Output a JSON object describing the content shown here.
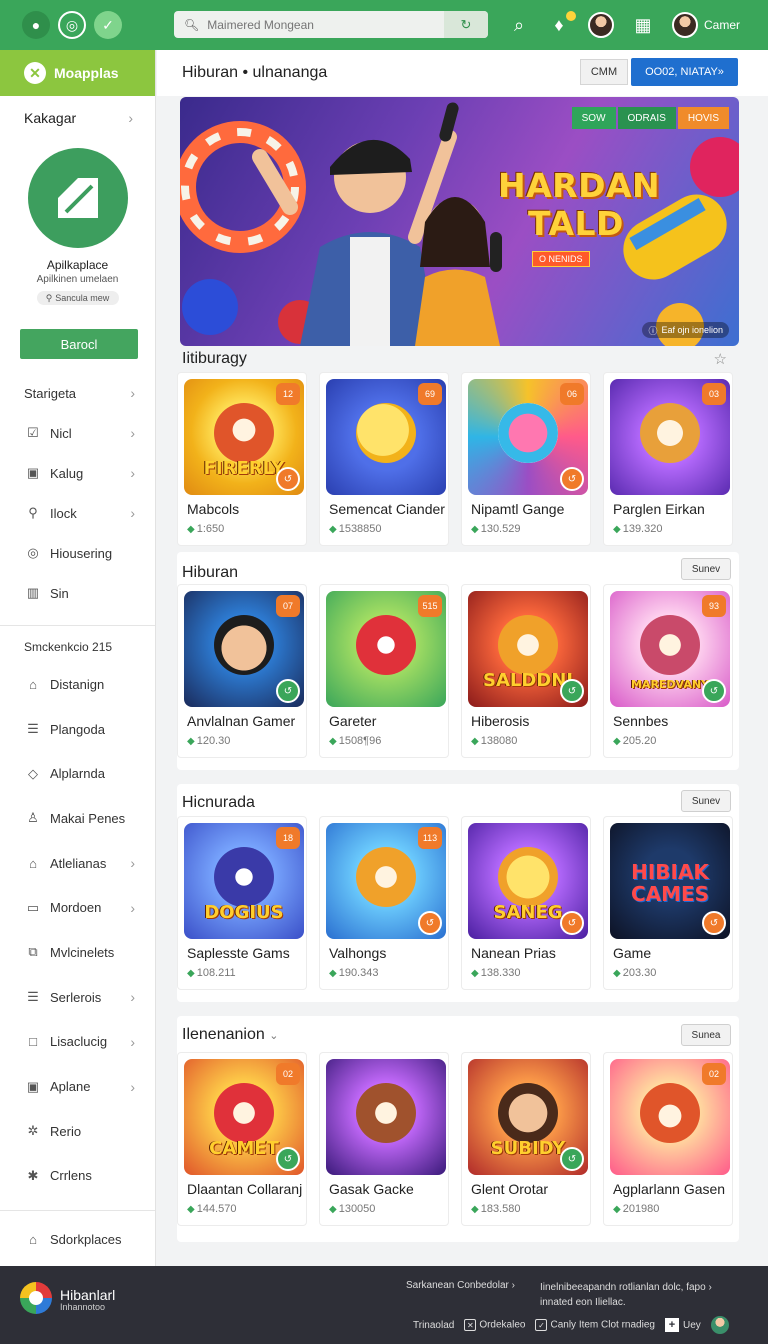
{
  "topbar": {
    "search_placeholder": "Maimered Mongean",
    "user_name": "Camer"
  },
  "sidebar": {
    "brand": "Moapplas",
    "heading": "Kakagar",
    "profile": {
      "name": "Apilkaplace",
      "subtitle": "Apilkinen umelaen",
      "tag": "Sancula mew"
    },
    "action_button": "Barocl",
    "items": [
      {
        "label": "Starigeta",
        "icon": "",
        "chevron": true
      },
      {
        "label": "Nicl",
        "icon": "checkbox-icon",
        "chevron": true
      },
      {
        "label": "Kalug",
        "icon": "photo-icon",
        "chevron": true
      },
      {
        "label": "Ilock",
        "icon": "location-icon",
        "chevron": true
      },
      {
        "label": "Hiousering",
        "icon": "target-icon",
        "chevron": false
      },
      {
        "label": "Sin",
        "icon": "columns-icon",
        "chevron": false
      }
    ],
    "section_label": "Smckenkcio 215",
    "items2": [
      {
        "label": "Distanign",
        "icon": "home-icon",
        "chevron": false
      },
      {
        "label": "Plangoda",
        "icon": "list-icon",
        "chevron": false
      },
      {
        "label": "Alplarnda",
        "icon": "tag-icon",
        "chevron": false
      },
      {
        "label": "Makai Penes",
        "icon": "user-icon",
        "chevron": false
      },
      {
        "label": "Atlelianas",
        "icon": "home-icon",
        "chevron": true
      },
      {
        "label": "Mordoen",
        "icon": "monitor-icon",
        "chevron": true
      },
      {
        "label": "Mvlcinelets",
        "icon": "layers-icon",
        "chevron": false
      },
      {
        "label": "Serlerois",
        "icon": "list-icon",
        "chevron": true
      },
      {
        "label": "Lisaclucig",
        "icon": "square-icon",
        "chevron": true
      },
      {
        "label": "Aplane",
        "icon": "photo-icon",
        "chevron": true
      },
      {
        "label": "Rerio",
        "icon": "gear-icon",
        "chevron": false
      },
      {
        "label": "Crrlens",
        "icon": "star-icon",
        "chevron": false
      }
    ],
    "bottom_item": "Sdorkplaces"
  },
  "main": {
    "title": "Hiburan • ulnananga",
    "btn_secondary": "CMM",
    "btn_primary": "OO02, NIATAY»"
  },
  "banner": {
    "chips": [
      "SOW",
      "ODRAIS",
      "HOVIS"
    ],
    "title_line1": "HARDAN",
    "title_line2": "TALD",
    "pill": "O NENIDS",
    "footer": "Eaf ojn ionelion"
  },
  "sections": [
    {
      "title": "Iitiburagy",
      "button": "",
      "cards": [
        {
          "name": "Mabcols",
          "meta": "1:650",
          "corner": "12",
          "word": "FIRERLY"
        },
        {
          "name": "Semencat Ciander",
          "meta": "1538850",
          "corner": "69",
          "word": ""
        },
        {
          "name": "Nipamtl Gange",
          "meta": "130.529",
          "corner": "06",
          "word": ""
        },
        {
          "name": "Parglen Eirkan",
          "meta": "139.320",
          "corner": "03",
          "word": ""
        }
      ]
    },
    {
      "title": "Hiburan",
      "button": "Sunev",
      "cards": [
        {
          "name": "Anvlalnan Gamer",
          "meta": "120.30",
          "corner": "07",
          "word": ""
        },
        {
          "name": "Gareter",
          "meta": "1508¶96",
          "corner": "515",
          "word": ""
        },
        {
          "name": "Hiberosis",
          "meta": "138080",
          "corner": "",
          "word": "SALDDNI"
        },
        {
          "name": "Sennbes",
          "meta": "205.20",
          "corner": "93",
          "word": "MAREDVANY"
        }
      ]
    },
    {
      "title": "Hicnurada",
      "button": "Sunev",
      "cards": [
        {
          "name": "Saplesste Gams",
          "meta": "108.211",
          "corner": "18",
          "word": "DOGIUS"
        },
        {
          "name": "Valhongs",
          "meta": "190.343",
          "corner": "113",
          "word": ""
        },
        {
          "name": "Nanean Prias",
          "meta": "138.330",
          "corner": "",
          "word": "SANEG"
        },
        {
          "name": "Game",
          "meta": "203.30",
          "corner": "",
          "word": "HIBIAK CAMES"
        }
      ]
    },
    {
      "title": "Ilenenanion",
      "button": "Sunea",
      "cards": [
        {
          "name": "Dlaantan Collaranj",
          "meta": "144.570",
          "corner": "02",
          "word": "CAMET"
        },
        {
          "name": "Gasak Gacke",
          "meta": "130050",
          "corner": "",
          "word": ""
        },
        {
          "name": "Glent Orotar",
          "meta": "183.580",
          "corner": "",
          "word": "SUBIDY"
        },
        {
          "name": "Agplarlann Gasen",
          "meta": "201980",
          "corner": "02",
          "word": ""
        }
      ]
    }
  ],
  "footer": {
    "brand": "Hibanlarl",
    "brand_sub": "Inhannotoo",
    "link_a": "Sarkanean Conbedolar",
    "link_b_line1": "Iinelnibeeapandn rotlianlan dolc, fapo",
    "link_b_line2": "innated eon Iliellac.",
    "row": [
      "Trinaolad",
      "Ordekaleo",
      "Canly Item Clot rnadieg",
      "Uey"
    ]
  }
}
